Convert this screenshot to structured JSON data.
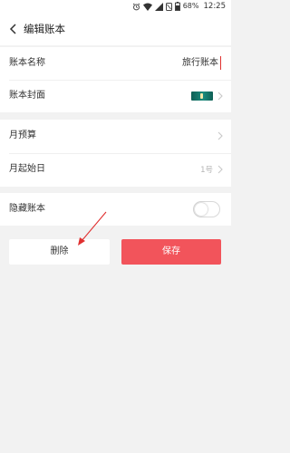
{
  "status_bar": {
    "battery_percent": "68%",
    "time": "12:25"
  },
  "header": {
    "back_icon": "chevron-left-icon",
    "title": "编辑账本"
  },
  "form": {
    "name_label": "账本名称",
    "name_value": "旅行账本",
    "cover_label": "账本封面",
    "budget_label": "月预算",
    "start_day_label": "月起始日",
    "start_day_value": "1号",
    "hide_label": "隐藏账本",
    "hide_enabled": false
  },
  "actions": {
    "delete_label": "删除",
    "save_label": "保存"
  },
  "colors": {
    "accent": "#f2545b",
    "annotation_arrow": "#e03030"
  }
}
